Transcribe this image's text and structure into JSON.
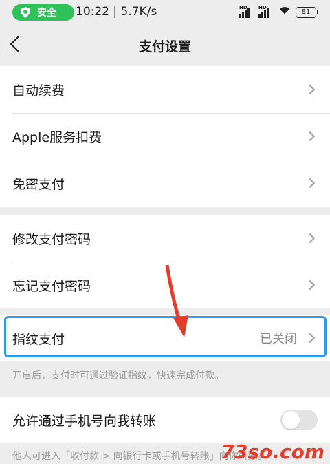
{
  "status_bar": {
    "safe_label": "安全",
    "time_speed": "10:22 | 5.7K/s",
    "battery": "81",
    "signal_tag": "HD"
  },
  "nav": {
    "title": "支付设置"
  },
  "group1": [
    {
      "label": "自动续费"
    },
    {
      "label": "Apple服务扣费"
    },
    {
      "label": "免密支付"
    }
  ],
  "group2": [
    {
      "label": "修改支付密码"
    },
    {
      "label": "忘记支付密码"
    }
  ],
  "fingerprint": {
    "label": "指纹支付",
    "value": "已关闭"
  },
  "fingerprint_hint": "开启后，支付时可通过验证指纹，快速完成付款。",
  "transfer": {
    "label": "允许通过手机号向我转账",
    "enabled": false
  },
  "transfer_hint": "他人可进入「收付款 > 向银行卡或手机号转账」向你转账。",
  "watermark": "73so.com",
  "colors": {
    "safe_green": "#2fc25b",
    "highlight_blue": "#2a9bf0",
    "arrow_red": "#e53b2a"
  }
}
